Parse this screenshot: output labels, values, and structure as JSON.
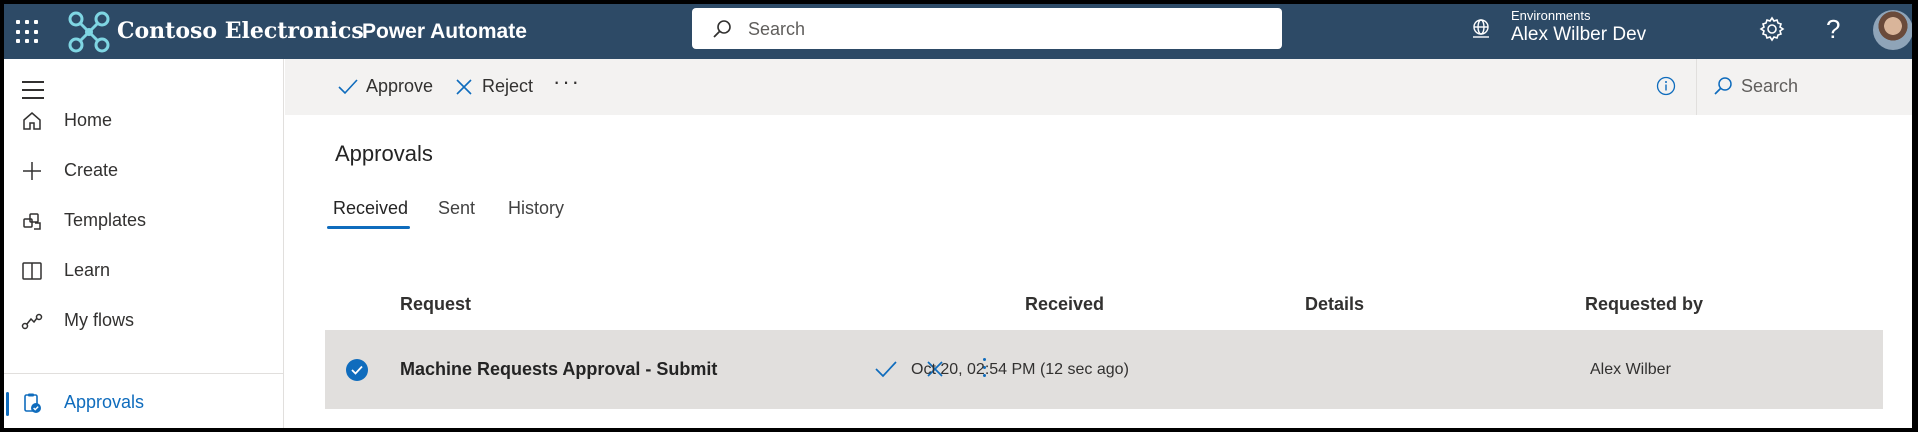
{
  "topbar": {
    "org_name": "Contoso Electronics",
    "app_name": "Power Automate",
    "search_placeholder": "Search",
    "environments_label": "Environments",
    "environment_name": "Alex Wilber Dev",
    "help_glyph": "?"
  },
  "leftnav": {
    "items": [
      {
        "label": "Home",
        "icon": "home-icon"
      },
      {
        "label": "Create",
        "icon": "plus-icon"
      },
      {
        "label": "Templates",
        "icon": "templates-icon"
      },
      {
        "label": "Learn",
        "icon": "book-icon"
      },
      {
        "label": "My flows",
        "icon": "flows-icon"
      },
      {
        "label": "Approvals",
        "icon": "approvals-icon",
        "active": true
      }
    ]
  },
  "commandbar": {
    "approve_label": "Approve",
    "reject_label": "Reject",
    "more_label": "···",
    "search_placeholder": "Search"
  },
  "main": {
    "title": "Approvals",
    "tabs": [
      {
        "label": "Received",
        "active": true
      },
      {
        "label": "Sent"
      },
      {
        "label": "History"
      }
    ],
    "columns": [
      "Request",
      "Received",
      "Details",
      "Requested by"
    ],
    "rows": [
      {
        "selected": true,
        "request": "Machine Requests Approval - Submit",
        "received": "Oct 20, 02:54 PM (12 sec ago)",
        "details": "",
        "requested_by": "Alex Wilber"
      }
    ]
  },
  "colors": {
    "header_bg": "#2d4a66",
    "accent": "#0f6cbd",
    "selected_row": "#e1dfdd",
    "command_bar_bg": "#f3f2f1"
  }
}
